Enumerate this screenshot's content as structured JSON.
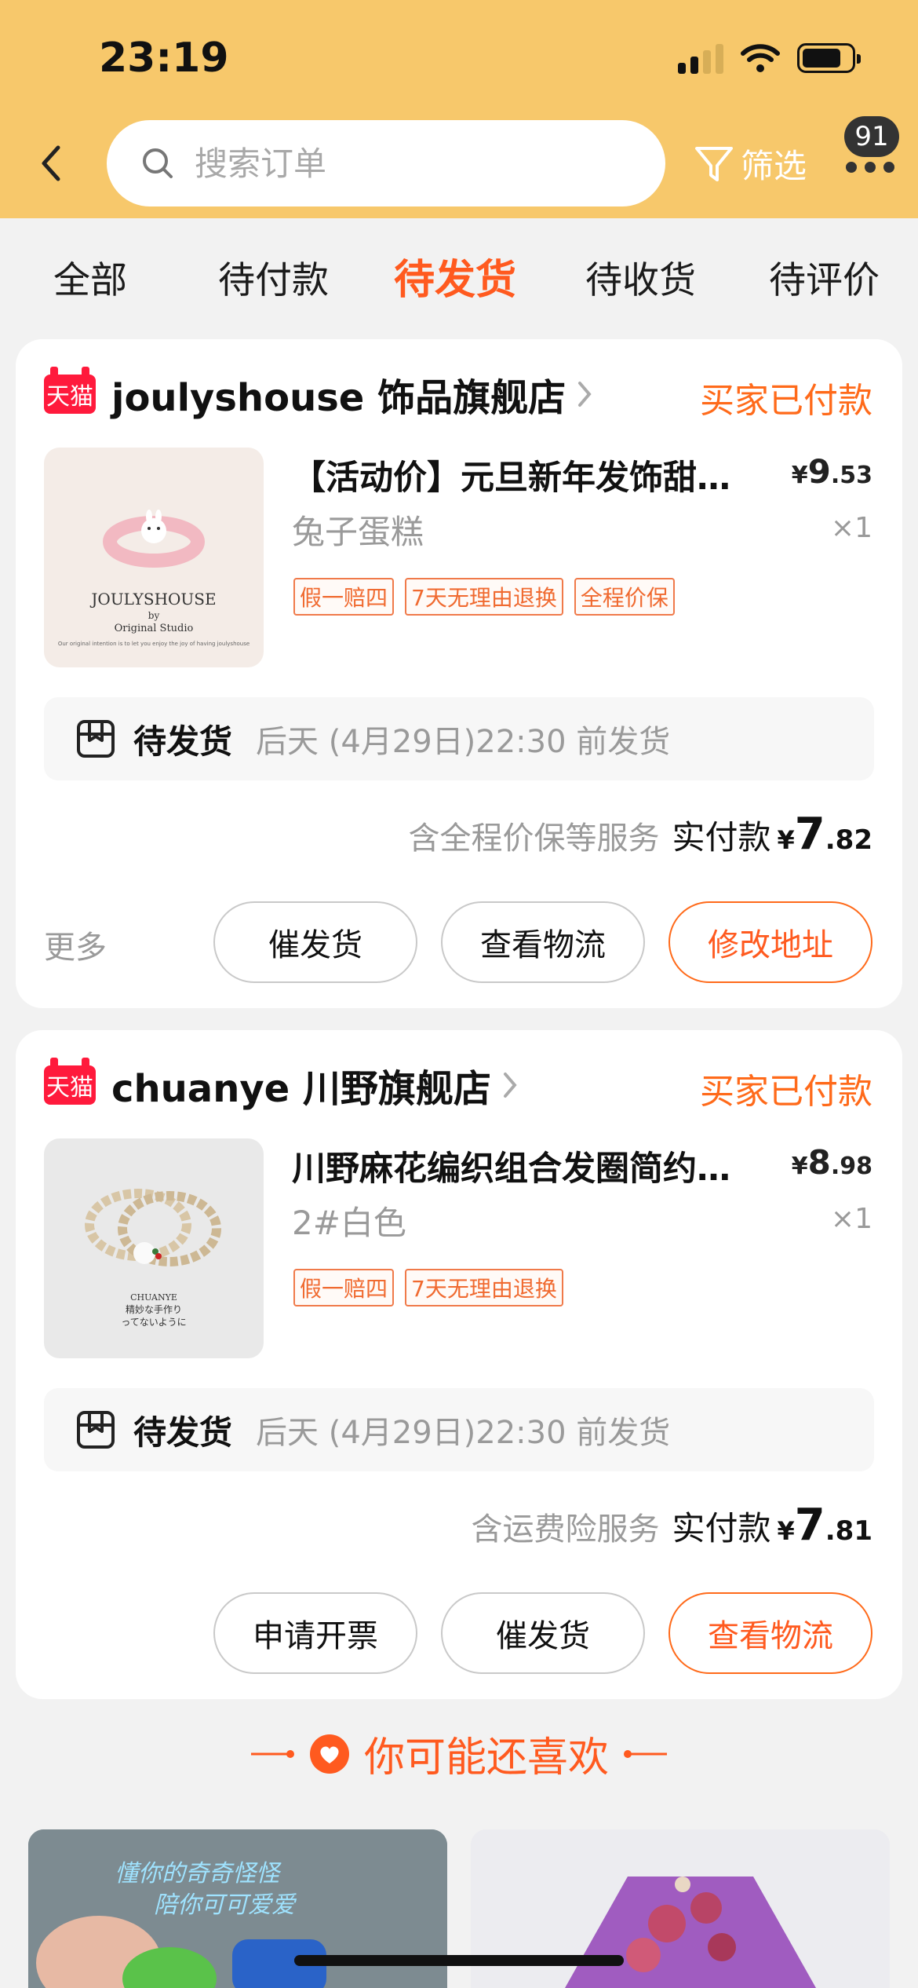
{
  "status_bar": {
    "time": "23:19"
  },
  "header": {
    "search_placeholder": "搜索订单",
    "filter_label": "筛选",
    "more_badge": "91"
  },
  "tabs": [
    {
      "label": "全部"
    },
    {
      "label": "待付款"
    },
    {
      "label": "待发货"
    },
    {
      "label": "待收货"
    },
    {
      "label": "待评价"
    }
  ],
  "active_tab": "待发货",
  "orders": [
    {
      "platform_badge": "天猫",
      "shop_name": "joulyshouse 饰品旗舰店",
      "status": "买家已付款",
      "thumb_brand": "JOULYSHOUSE",
      "thumb_sub": "by",
      "thumb_studio": "Original Studio",
      "thumb_note": "Our original intention is to let you enjoy the joy of having joulyshouse",
      "title": "【活动价】元旦新年发饰甜…",
      "price_yen": "¥",
      "price_int": "9",
      "price_dec": ".53",
      "variant": "兔子蛋糕",
      "qty": "×1",
      "tags": [
        "假一赔四",
        "7天无理由退换",
        "全程价保"
      ],
      "ship_label": "待发货",
      "ship_note": "后天 (4月29日)22:30 前发货",
      "service_note": "含全程价保等服务",
      "paid_label": "实付款",
      "paid_yen": "¥",
      "paid_int": "7",
      "paid_dec": ".82",
      "more_label": "更多",
      "buttons": [
        "催发货",
        "查看物流",
        "修改地址"
      ]
    },
    {
      "platform_badge": "天猫",
      "shop_name": "chuanye 川野旗舰店",
      "status": "买家已付款",
      "thumb_brand": "CHUANYE",
      "thumb_sub": "精妙な手作り",
      "thumb_studio": "ってないように",
      "title": "川野麻花编织组合发圈简约…",
      "price_yen": "¥",
      "price_int": "8",
      "price_dec": ".98",
      "variant": "2#白色",
      "qty": "×1",
      "tags": [
        "假一赔四",
        "7天无理由退换"
      ],
      "ship_label": "待发货",
      "ship_note": "后天 (4月29日)22:30 前发货",
      "service_note": "含运费险服务",
      "paid_label": "实付款",
      "paid_yen": "¥",
      "paid_int": "7",
      "paid_dec": ".81",
      "buttons": [
        "申请开票",
        "催发货",
        "查看物流"
      ]
    }
  ],
  "recommend": {
    "title": "你可能还喜欢",
    "card1_caption_1": "懂你的奇奇怪怪",
    "card1_caption_2": "陪你可可爱爱"
  },
  "colors": {
    "header_bg": "#f7c86b",
    "accent": "#ff5a1f",
    "tmall_red": "#ff1a3c",
    "page_bg": "#f2f2f2"
  }
}
